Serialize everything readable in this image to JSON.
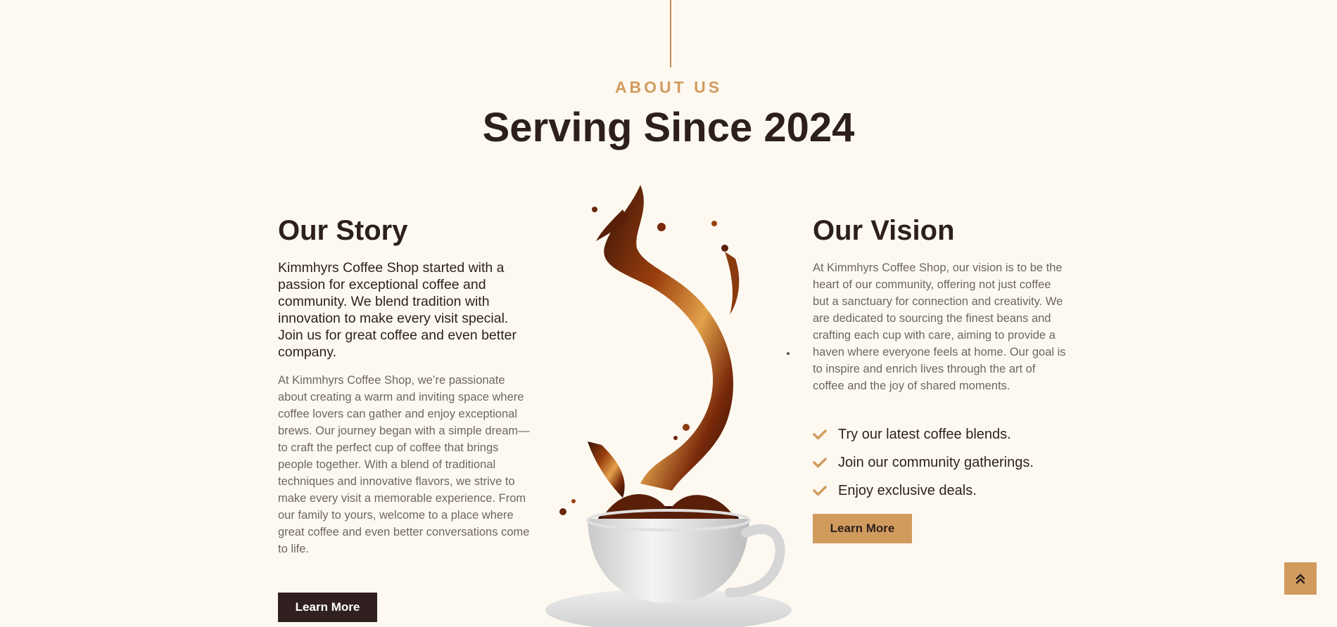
{
  "section": {
    "eyebrow": "ABOUT US",
    "title": "Serving Since 2024"
  },
  "story": {
    "title": "Our Story",
    "lead": "Kimmhyrs Coffee Shop started with a passion for exceptional coffee and community. We blend tradition with innovation to make every visit special. Join us for great coffee and even better company.",
    "body": "At Kimmhyrs Coffee Shop, we’re passionate about creating a warm and inviting space where coffee lovers can gather and enjoy exceptional brews. Our journey began with a simple dream—to craft the perfect cup of coffee that brings people together. With a blend of traditional techniques and innovative flavors, we strive to make every visit a memorable experience. From our family to yours, welcome to a place where great coffee and even better conversations come to life.",
    "button_label": "Learn More"
  },
  "vision": {
    "title": "Our Vision",
    "body": "At Kimmhyrs Coffee Shop, our vision is to be the heart of our community, offering not just coffee but a sanctuary for connection and creativity. We are dedicated to sourcing the finest beans and crafting each cup with care, aiming to provide a haven where everyone feels at home. Our goal is to inspire and enrich lives through the art of coffee and the joy of shared moments.",
    "checklist": [
      "Try our latest coffee blends.",
      "Join our community gatherings.",
      "Enjoy exclusive deals."
    ],
    "button_label": "Learn More"
  },
  "icons": {
    "check": "check-icon",
    "scroll_top": "double-chevron-up-icon"
  },
  "colors": {
    "background": "#fdf9f1",
    "accent": "#d19b5e",
    "dark": "#302120",
    "muted_text": "#6e6660"
  }
}
